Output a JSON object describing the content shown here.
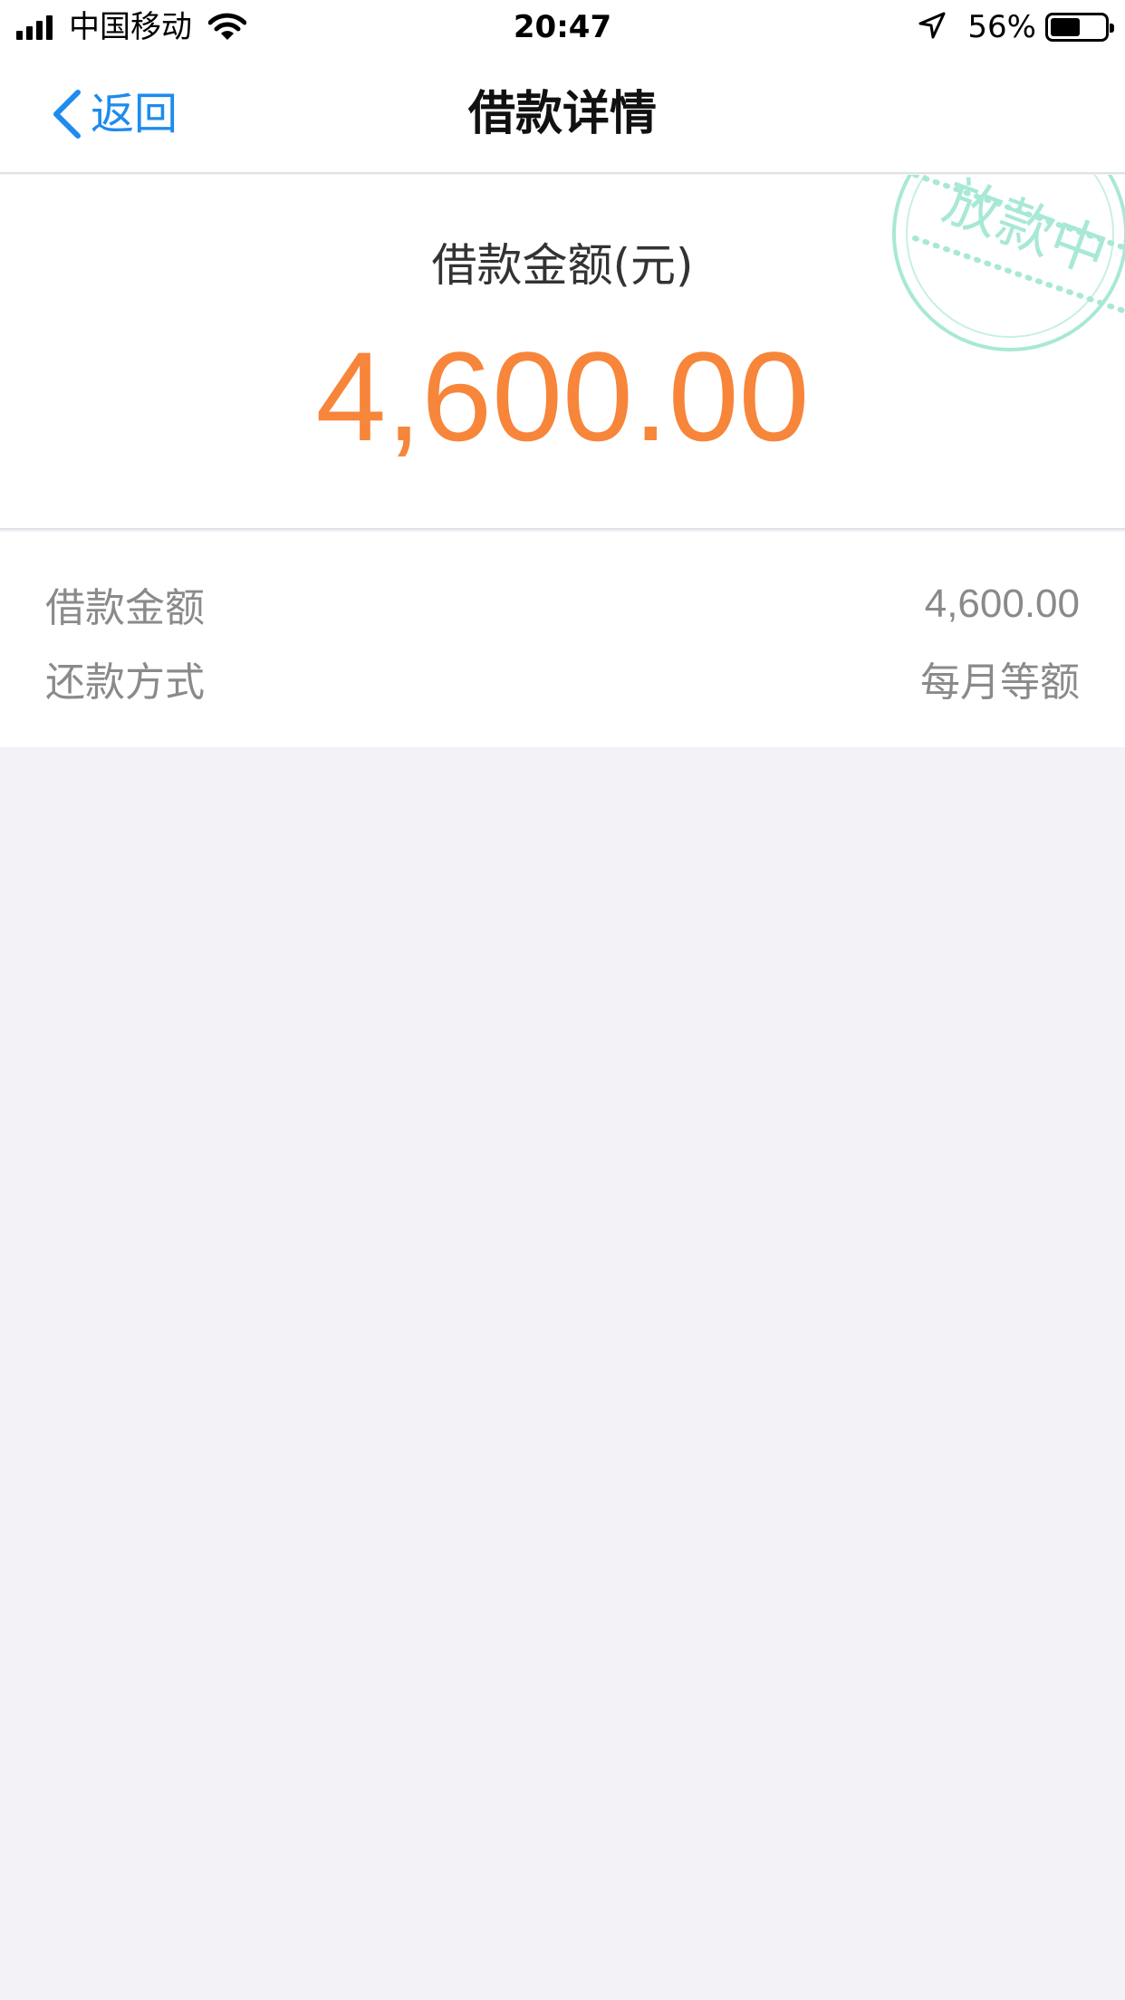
{
  "status_bar": {
    "carrier": "中国移动",
    "time": "20:47",
    "battery_percent": "56%",
    "battery_level": 0.56,
    "icons": [
      "signal-icon",
      "wifi-icon",
      "location-arrow-icon",
      "battery-icon"
    ]
  },
  "nav": {
    "back_label": "返回",
    "title": "借款详情",
    "back_icon": "chevron-left-icon"
  },
  "hero": {
    "label": "借款金额(元)",
    "amount": "4,600.00",
    "stamp_text": "放款中"
  },
  "details": {
    "rows": [
      {
        "label": "借款金额",
        "value": "4,600.00"
      },
      {
        "label": "还款方式",
        "value": "每月等额"
      }
    ]
  },
  "colors": {
    "accent": "#1e8bee",
    "amount": "#f7853a",
    "stamp": "#9fe3cf",
    "background": "#f2f2f7"
  }
}
